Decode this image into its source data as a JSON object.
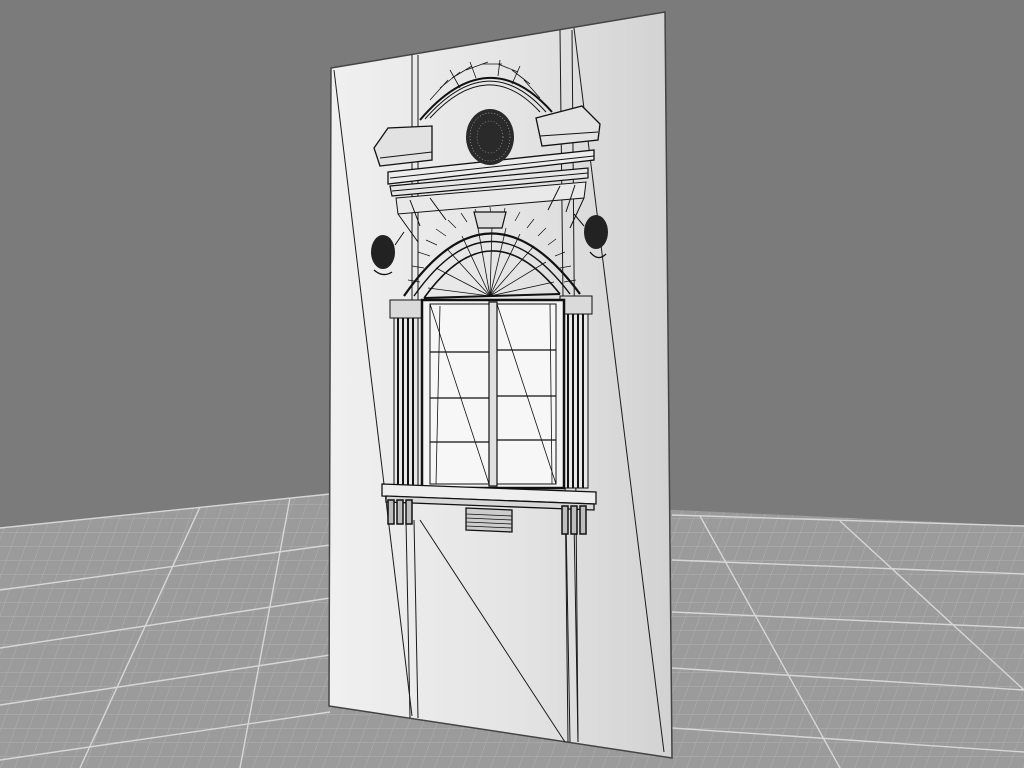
{
  "viewport": {
    "background_color": "#7b7b7b",
    "floor_color": "#9a9a9a",
    "grid_minor_color": "#b4b4b4",
    "grid_major_color": "#d8d8d8"
  },
  "model": {
    "panel_color": "#e6e6e6",
    "panel_edge_color": "#3a3a3a",
    "wire_color": "#111111",
    "glass_color": "#f2f2f2",
    "shading": "white-with-wireframe"
  }
}
